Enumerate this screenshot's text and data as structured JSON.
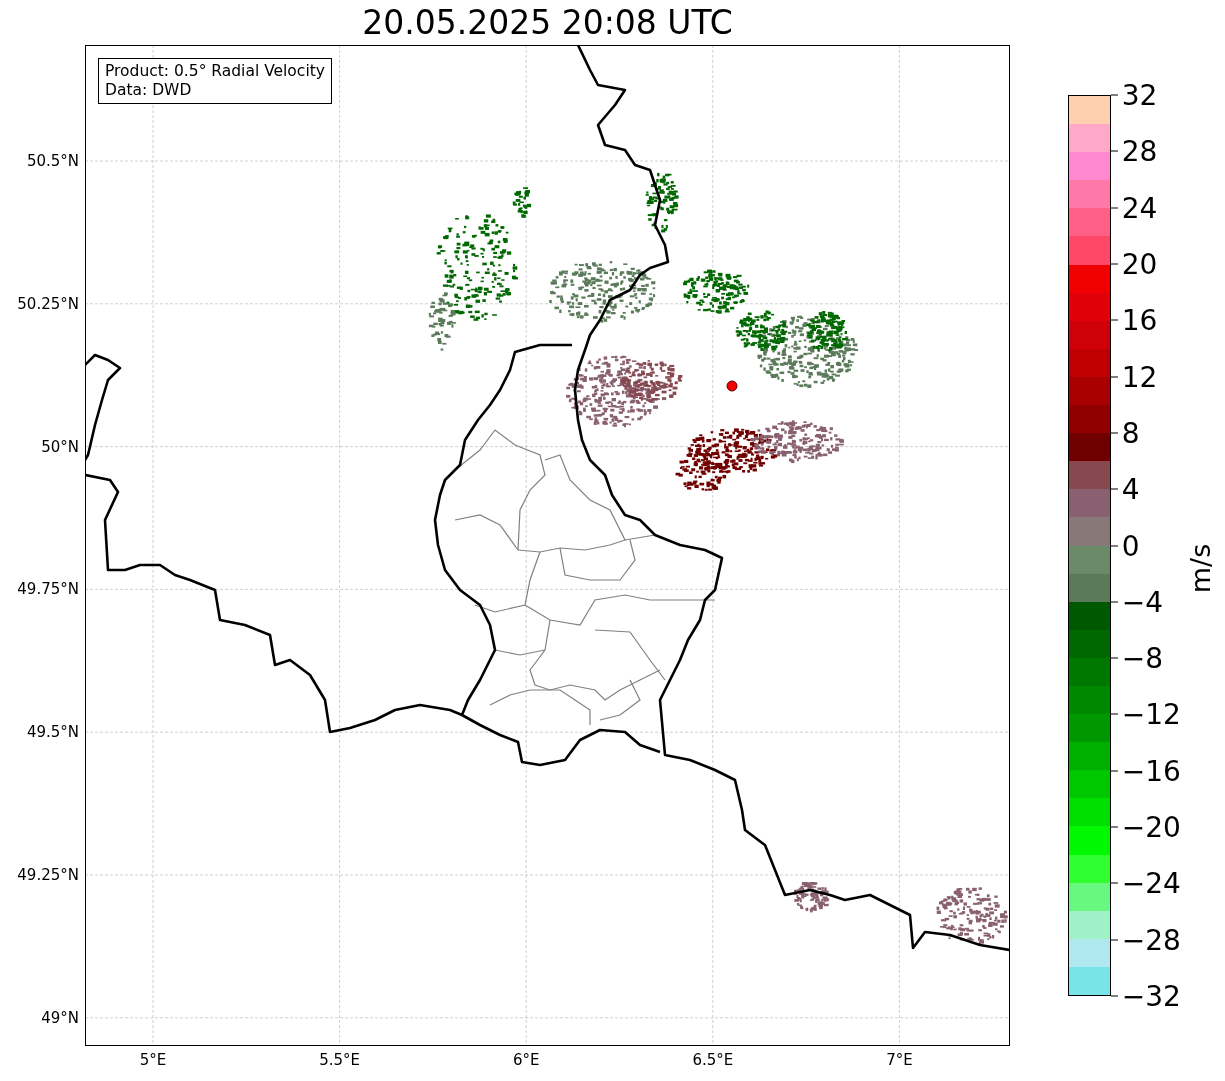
{
  "title": "20.05.2025 20:08 UTC",
  "legend": [
    "Product: 0.5° Radial Velocity",
    "Data: DWD"
  ],
  "axes": {
    "xticks": [
      "5°E",
      "5.5°E",
      "6°E",
      "6.5°E",
      "7°E"
    ],
    "yticks": [
      "50.5°N",
      "50.25°N",
      "50°N",
      "49.75°N",
      "49.5°N",
      "49.25°N",
      "49°N"
    ]
  },
  "colorbar": {
    "label": "m/s",
    "ticks": [
      "32",
      "28",
      "24",
      "20",
      "16",
      "12",
      "8",
      "4",
      "0",
      "−4",
      "−8",
      "−12",
      "−16",
      "−20",
      "−24",
      "−28",
      "−32"
    ],
    "bins": [
      {
        "color": "#ffd0b0"
      },
      {
        "color": "#ffa8c8"
      },
      {
        "color": "#ff88d0"
      },
      {
        "color": "#ff78a8"
      },
      {
        "color": "#ff6088"
      },
      {
        "color": "#ff4868"
      },
      {
        "color": "#f00000"
      },
      {
        "color": "#e00008"
      },
      {
        "color": "#d00008"
      },
      {
        "color": "#c00000"
      },
      {
        "color": "#a80000"
      },
      {
        "color": "#900000"
      },
      {
        "color": "#700000"
      },
      {
        "color": "#884850"
      },
      {
        "color": "#886070"
      },
      {
        "color": "#887878"
      },
      {
        "color": "#6a8a6a"
      },
      {
        "color": "#5a7a5a"
      },
      {
        "color": "#005800"
      },
      {
        "color": "#006800"
      },
      {
        "color": "#007800"
      },
      {
        "color": "#008800"
      },
      {
        "color": "#009800"
      },
      {
        "color": "#00b000"
      },
      {
        "color": "#00c800"
      },
      {
        "color": "#00e000"
      },
      {
        "color": "#00f800"
      },
      {
        "color": "#30ff30"
      },
      {
        "color": "#68f880"
      },
      {
        "color": "#a0f0c8"
      },
      {
        "color": "#b0e8f0"
      },
      {
        "color": "#78e4e8"
      }
    ]
  }
}
